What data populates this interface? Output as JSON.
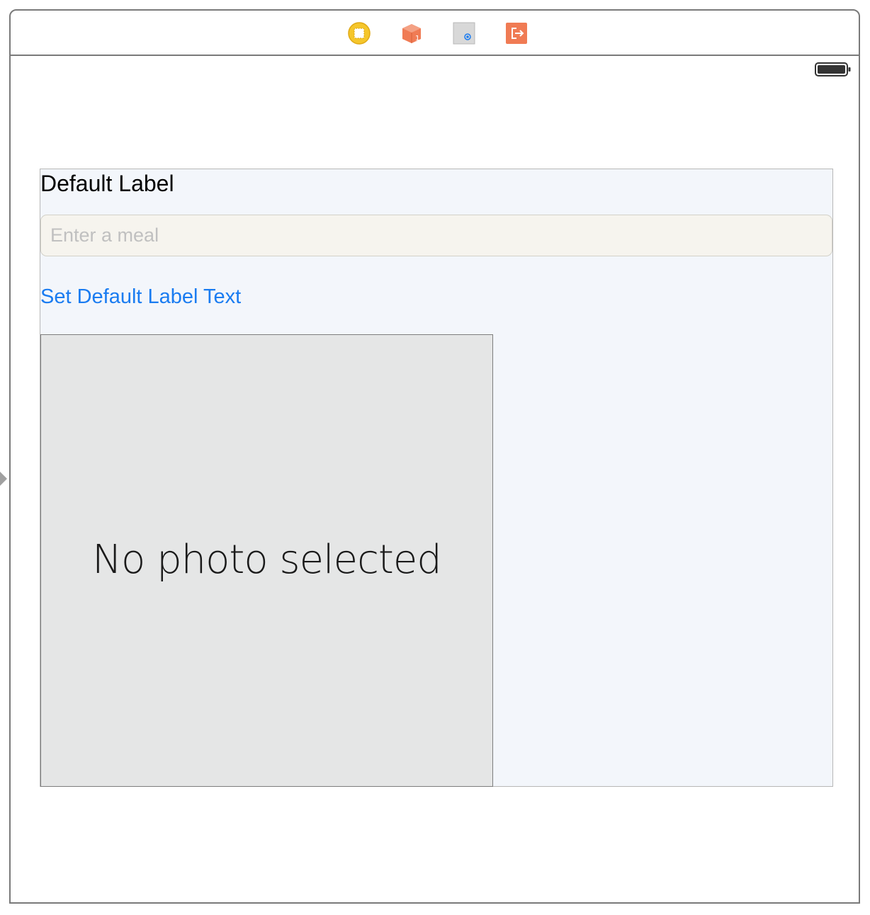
{
  "dock": {
    "icons": [
      {
        "name": "view-controller-icon",
        "color": "#f5c62b"
      },
      {
        "name": "first-responder-icon",
        "color": "#f07b54"
      },
      {
        "name": "tap-gesture-icon",
        "color": "#d8d8d8"
      },
      {
        "name": "exit-icon",
        "color": "#f07b54"
      }
    ]
  },
  "status_bar": {
    "battery_icon": "battery-full-icon"
  },
  "content": {
    "label_text": "Default Label",
    "text_field_placeholder": "Enter a meal",
    "text_field_value": "",
    "button_label": "Set Default Label Text",
    "photo_placeholder_text": "No photo selected"
  },
  "colors": {
    "accent": "#1a7cf1",
    "stack_background": "#f3f6fb",
    "photo_background": "#e5e6e6",
    "field_background": "#f6f4ee"
  }
}
